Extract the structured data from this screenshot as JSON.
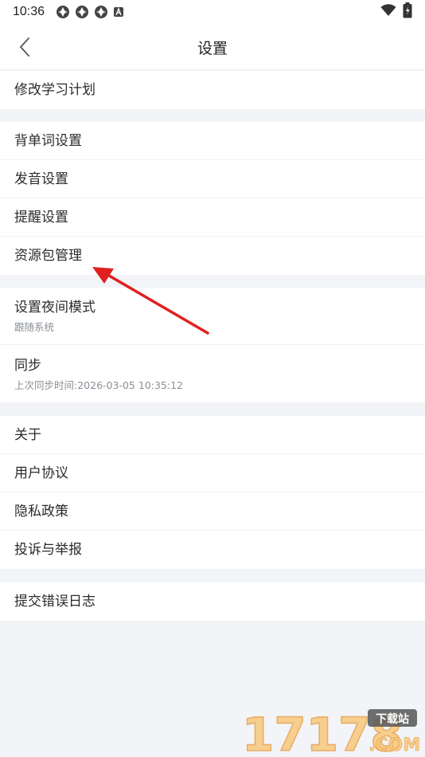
{
  "status_bar": {
    "time": "10:36",
    "icons": [
      "app-notification-icon",
      "app-notification-icon",
      "app-notification-icon",
      "a-notification-icon",
      "wifi-icon",
      "battery-icon"
    ]
  },
  "header": {
    "title": "设置",
    "back_icon": "chevron-left-icon"
  },
  "groups": [
    {
      "items": [
        {
          "label": "修改学习计划"
        }
      ]
    },
    {
      "items": [
        {
          "label": "背单词设置"
        },
        {
          "label": "发音设置"
        },
        {
          "label": "提醒设置"
        },
        {
          "label": "资源包管理"
        }
      ]
    },
    {
      "items": [
        {
          "label": "设置夜间模式",
          "sub": "跟随系统"
        },
        {
          "label": "同步",
          "sub": "上次同步时间:2026-03-05 10:35:12"
        }
      ]
    },
    {
      "items": [
        {
          "label": "关于"
        },
        {
          "label": "用户协议"
        },
        {
          "label": "隐私政策"
        },
        {
          "label": "投诉与举报"
        }
      ]
    },
    {
      "items": [
        {
          "label": "提交错误日志"
        }
      ]
    }
  ],
  "annotation": {
    "color": "#e02020",
    "target": "资源包管理"
  },
  "watermark": {
    "number": "17178",
    "badge": "下载站",
    "suffix": ".COM"
  },
  "colors": {
    "background": "#f2f4f7",
    "surface": "#ffffff",
    "text": "#2b2b2b",
    "subtext": "#8a8f96",
    "accent_arrow": "#e02020"
  }
}
